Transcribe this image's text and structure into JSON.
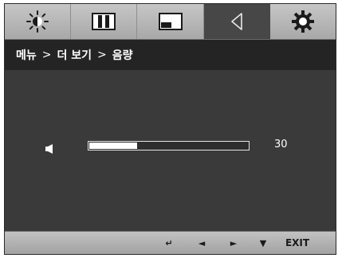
{
  "tabs": [
    {
      "icon": "brightness-icon",
      "active": false
    },
    {
      "icon": "picture-icon",
      "active": false
    },
    {
      "icon": "screen-icon",
      "active": false
    },
    {
      "icon": "speaker-icon",
      "active": true
    },
    {
      "icon": "settings-gear-icon",
      "active": false
    }
  ],
  "breadcrumb": {
    "items": [
      "메뉴",
      "더 보기",
      "음량"
    ],
    "separator": ">"
  },
  "volume": {
    "icon": "volume-speaker-icon",
    "level": 30,
    "max": 100,
    "value_text": "30"
  },
  "bottom_bar": {
    "buttons": [
      {
        "icon": "return-arrow-icon",
        "label": "↵"
      },
      {
        "icon": "left-arrow-icon",
        "label": "◄"
      },
      {
        "icon": "right-arrow-icon",
        "label": "►"
      },
      {
        "icon": "down-arrow-icon",
        "label": "▼"
      },
      {
        "icon": "exit-label",
        "label": "EXIT"
      }
    ]
  },
  "colors": {
    "panel": "#3a3a3a",
    "tab_bar": "#b5b5b5",
    "active_tab": "#474747",
    "breadcrumb_bar": "#242424",
    "text": "#ffffff"
  }
}
